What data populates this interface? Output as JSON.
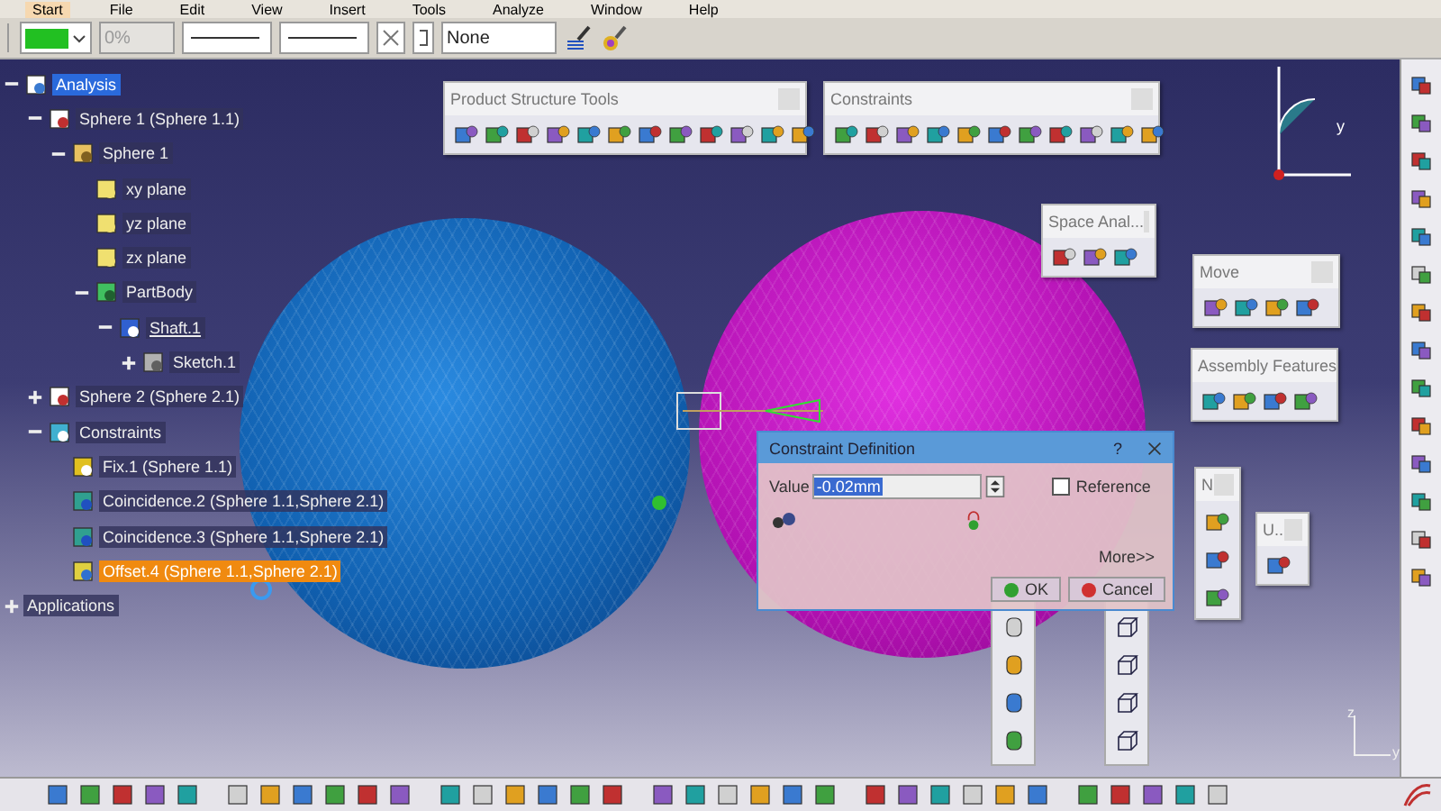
{
  "menu": [
    {
      "label": "Start",
      "selected": true
    },
    {
      "label": "File",
      "selected": false
    },
    {
      "label": "Edit",
      "selected": false
    },
    {
      "label": "View",
      "selected": false
    },
    {
      "label": "Insert",
      "selected": false
    },
    {
      "label": "Tools",
      "selected": false
    },
    {
      "label": "Analyze",
      "selected": false
    },
    {
      "label": "Window",
      "selected": false
    },
    {
      "label": "Help",
      "selected": false
    }
  ],
  "format_toolbar": {
    "fill": {
      "color": "#22c022"
    },
    "transparency": {
      "value": "0%",
      "disabled": true
    },
    "layer": "None"
  },
  "tree": [
    {
      "label": "Analysis",
      "kind": "analysis",
      "selected": false,
      "active": true,
      "in_work": false,
      "expanded": true,
      "children": [
        {
          "label": "Sphere 1 (Sphere 1.1)",
          "kind": "product",
          "selected": false,
          "active": false,
          "in_work": false,
          "expanded": true,
          "children": [
            {
              "label": "Sphere 1",
              "kind": "part",
              "selected": false,
              "active": false,
              "in_work": false,
              "expanded": true,
              "children": [
                {
                  "label": "xy plane",
                  "kind": "plane",
                  "selected": false,
                  "active": false,
                  "in_work": false
                },
                {
                  "label": "yz plane",
                  "kind": "plane",
                  "selected": false,
                  "active": false,
                  "in_work": false
                },
                {
                  "label": "zx plane",
                  "kind": "plane",
                  "selected": false,
                  "active": false,
                  "in_work": false
                },
                {
                  "label": "PartBody",
                  "kind": "body",
                  "selected": false,
                  "active": false,
                  "in_work": false,
                  "expanded": true,
                  "children": [
                    {
                      "label": "Shaft.1",
                      "kind": "shaft",
                      "selected": false,
                      "active": false,
                      "in_work": true,
                      "expanded": true,
                      "children": [
                        {
                          "label": "Sketch.1",
                          "kind": "sketch",
                          "selected": false,
                          "active": false,
                          "in_work": false,
                          "expanded": false
                        }
                      ]
                    }
                  ]
                }
              ]
            }
          ]
        },
        {
          "label": "Sphere 2 (Sphere 2.1)",
          "kind": "product",
          "selected": false,
          "active": false,
          "in_work": false,
          "expanded": false
        },
        {
          "label": "Constraints",
          "kind": "constraints",
          "selected": false,
          "active": false,
          "in_work": false,
          "expanded": true,
          "children": [
            {
              "label": "Fix.1 (Sphere 1.1)",
              "kind": "fix",
              "selected": false,
              "active": false,
              "in_work": false
            },
            {
              "label": "Coincidence.2 (Sphere 1.1,Sphere 2.1)",
              "kind": "coincidence",
              "selected": false,
              "active": false,
              "in_work": false
            },
            {
              "label": "Coincidence.3 (Sphere 1.1,Sphere 2.1)",
              "kind": "coincidence",
              "selected": false,
              "active": false,
              "in_work": false
            },
            {
              "label": "Offset.4 (Sphere 1.1,Sphere 2.1)",
              "kind": "offset",
              "selected": true,
              "active": false,
              "in_work": false
            }
          ]
        }
      ]
    },
    {
      "label": "Applications",
      "kind": "applications",
      "selected": false,
      "active": false,
      "in_work": false,
      "expanded": false
    }
  ],
  "toolbars": [
    {
      "title": "Product Structure Tools",
      "kind": "product"
    },
    {
      "title": "Constraints",
      "kind": "constraints"
    },
    {
      "title": "Space Anal...",
      "kind": "space"
    },
    {
      "title": "Move",
      "kind": "move"
    },
    {
      "title": "Assembly Features",
      "kind": "assembly"
    },
    {
      "title": "N",
      "kind": "measure"
    },
    {
      "title": "U..",
      "kind": "update"
    }
  ],
  "dialog": {
    "title": "Constraint Definition",
    "help": "?",
    "value_label": "Value",
    "value": "-0.02mm",
    "reference": {
      "label": "Reference",
      "checked": false
    },
    "buttons": [
      {
        "label": "More>>",
        "kind": "more"
      },
      {
        "label": "OK",
        "kind": "ok"
      },
      {
        "label": "Cancel",
        "kind": "cancel"
      }
    ]
  },
  "compass_labels": [
    "y"
  ],
  "axis_labels": [
    "z",
    "y"
  ]
}
